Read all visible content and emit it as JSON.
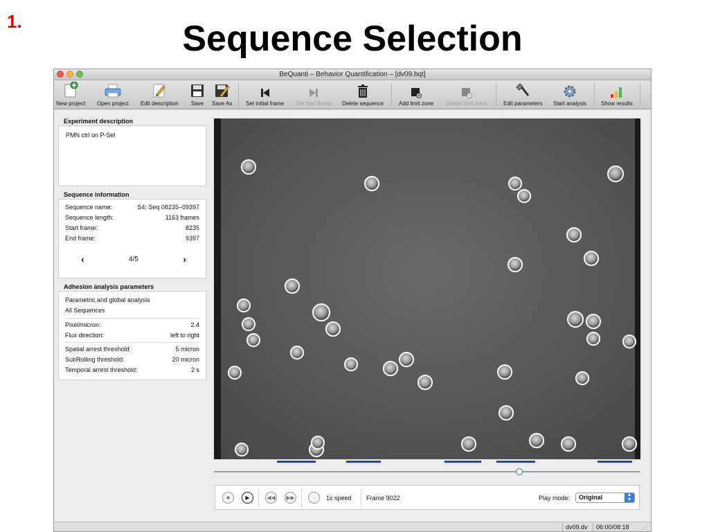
{
  "slide": {
    "number": "1.",
    "title": "Sequence Selection"
  },
  "window": {
    "title": "BeQuanti – Behavior Quantification – [dv09.bqt]"
  },
  "toolbar": {
    "new_project": "New project",
    "open_project": "Open project",
    "edit_description": "Edit description",
    "save": "Save",
    "save_as": "Save As",
    "set_initial_frame": "Set initial frame",
    "set_final_frame": "Set final frame",
    "delete_sequence": "Delete sequence",
    "add_limit_zone": "Add limit zone",
    "delete_limit_zone": "Delete limit zone",
    "edit_parameters": "Edit parameters",
    "start_analysis": "Start analysis",
    "show_results": "Show results"
  },
  "experiment": {
    "heading": "Experiment description",
    "text": "PMN ctrl on P-Sel"
  },
  "sequence": {
    "heading": "Sequence information",
    "name_label": "Sequence name:",
    "name_value": "S4: Seq 08235–09397",
    "length_label": "Sequence length:",
    "length_value": "1163 frames",
    "start_label": "Start frame:",
    "start_value": "8235",
    "end_label": "End frame:",
    "end_value": "9397",
    "prev": "‹",
    "next": "›",
    "pager": "4/5"
  },
  "adhesion": {
    "heading": "Adhesion analysis parameters",
    "mode": "Parametric and global analysis",
    "scope": "All Sequences",
    "pixel_label": "Pixel/micron:",
    "pixel_value": "2.4",
    "flux_label": "Flux direction:",
    "flux_value": "left to right",
    "spatial_label": "Spatial arrest threshold:",
    "spatial_value": "5 micron",
    "subrolling_label": "SubRolling threshold:",
    "subrolling_value": "20 micron",
    "temporal_label": "Temporal arrest threshold:",
    "temporal_value": "2 s"
  },
  "timeline": {
    "position_fraction": 0.716,
    "sequence_marks": [
      [
        0.147,
        0.238
      ],
      [
        0.31,
        0.392
      ],
      [
        0.54,
        0.627
      ],
      [
        0.662,
        0.753
      ],
      [
        0.899,
        0.98
      ]
    ]
  },
  "controls": {
    "stop_icon": "stop-icon",
    "play_icon": "play-icon",
    "rewind_icon": "rewind-icon",
    "forward_icon": "fast-forward-icon",
    "speed": "1x speed",
    "frame": "Frame 9022",
    "play_mode_label": "Play mode:",
    "play_mode_value": "Original"
  },
  "status": {
    "file": "dv09.dv",
    "time": "06:00/08:18"
  }
}
